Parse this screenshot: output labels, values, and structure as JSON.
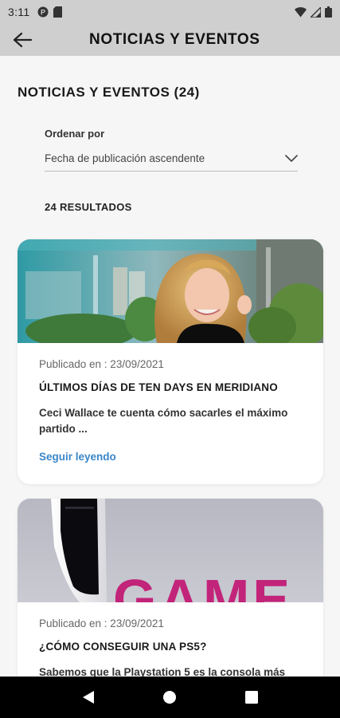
{
  "status_bar": {
    "time": "3:11"
  },
  "app_bar": {
    "title": "NOTICIAS Y EVENTOS"
  },
  "page": {
    "heading": "NOTICIAS Y EVENTOS (24)",
    "sort_label": "Ordenar por",
    "sort_value": "Fecha de publicación ascendente",
    "results": "24 RESULTADOS"
  },
  "cards": [
    {
      "date": "Publicado en : 23/09/2021",
      "title": "ÚLTIMOS DÍAS DE TEN DAYS EN MERIDIANO",
      "summary": "Ceci Wallace te cuenta cómo sacarles el máximo partido ...",
      "link": "Seguir leyendo"
    },
    {
      "date": "Publicado en : 23/09/2021",
      "title": "¿CÓMO CONSEGUIR UNA PS5?",
      "summary": "Sabemos que la Playstation 5 es la consola más",
      "banner_text": "GAME"
    }
  ]
}
